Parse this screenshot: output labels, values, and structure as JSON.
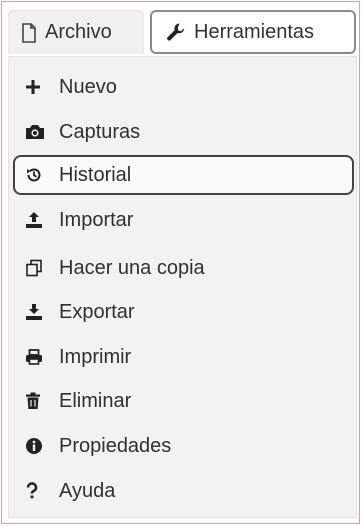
{
  "tabs": {
    "archivo": {
      "label": "Archivo",
      "icon": "file-icon"
    },
    "herramientas": {
      "label": "Herramientas",
      "icon": "wrench-icon"
    }
  },
  "menu": {
    "items": [
      {
        "label": "Nuevo",
        "icon": "plus-icon"
      },
      {
        "label": "Capturas",
        "icon": "camera-icon"
      },
      {
        "label": "Historial",
        "icon": "history-icon",
        "active": true
      },
      {
        "label": "Importar",
        "icon": "upload-icon"
      },
      {
        "label": "Hacer una copia",
        "icon": "copy-icon"
      },
      {
        "label": "Exportar",
        "icon": "download-icon"
      },
      {
        "label": "Imprimir",
        "icon": "print-icon"
      },
      {
        "label": "Eliminar",
        "icon": "trash-icon"
      },
      {
        "label": "Propiedades",
        "icon": "info-icon"
      },
      {
        "label": "Ayuda",
        "icon": "question-icon"
      }
    ]
  },
  "colors": {
    "frame_border": "#e79a9a",
    "menu_bg": "#f2f2f2",
    "active_border": "#444444"
  }
}
